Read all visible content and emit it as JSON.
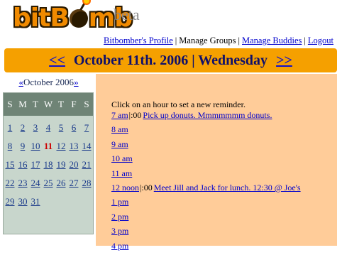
{
  "brand": {
    "logo_before": "bitB",
    "logo_after": "mb",
    "tag": "beta"
  },
  "topnav": {
    "profile": "Bitbomber's Profile",
    "groups": "Manage Groups",
    "buddies": "Manage Buddies",
    "logout": "Logout",
    "sep": "|"
  },
  "datebar": {
    "prev": "<<",
    "date": "October 11th. 2006 | Wednesday",
    "next": ">>"
  },
  "calendar": {
    "prev": "«",
    "month": "October 2006",
    "next": "»",
    "weekdays": [
      "S",
      "M",
      "T",
      "W",
      "T",
      "F",
      "S"
    ],
    "days": [
      "1",
      "2",
      "3",
      "4",
      "5",
      "6",
      "7",
      "8",
      "9",
      "10",
      "11",
      "12",
      "13",
      "14",
      "15",
      "16",
      "17",
      "18",
      "19",
      "20",
      "21",
      "22",
      "23",
      "24",
      "25",
      "26",
      "27",
      "28",
      "29",
      "30",
      "31"
    ],
    "today": "11"
  },
  "main": {
    "hint": "Click on an hour to set a new reminder.",
    "hours": [
      {
        "label": "7 am",
        "min": "|:00",
        "note": "Pick up donuts. Mmmmmmm donuts."
      },
      {
        "label": "8 am",
        "min": "",
        "note": ""
      },
      {
        "label": "9 am",
        "min": "",
        "note": ""
      },
      {
        "label": "10 am",
        "min": "",
        "note": ""
      },
      {
        "label": "11 am",
        "min": "",
        "note": ""
      },
      {
        "label": "12 noon",
        "min": "|:00",
        "note": "Meet Jill and Jack for lunch. 12:30 @ Joe's"
      },
      {
        "label": "1 pm",
        "min": "",
        "note": ""
      },
      {
        "label": "2 pm",
        "min": "",
        "note": ""
      },
      {
        "label": "3 pm",
        "min": "",
        "note": ""
      },
      {
        "label": "4 pm",
        "min": "",
        "note": ""
      }
    ]
  },
  "colors": {
    "orange": "#f5a000",
    "panel": "#ffcc99",
    "cal_head": "#6f8476",
    "cal_bg": "#c8d6cc",
    "link": "#0000cc",
    "today": "#cc0000"
  }
}
